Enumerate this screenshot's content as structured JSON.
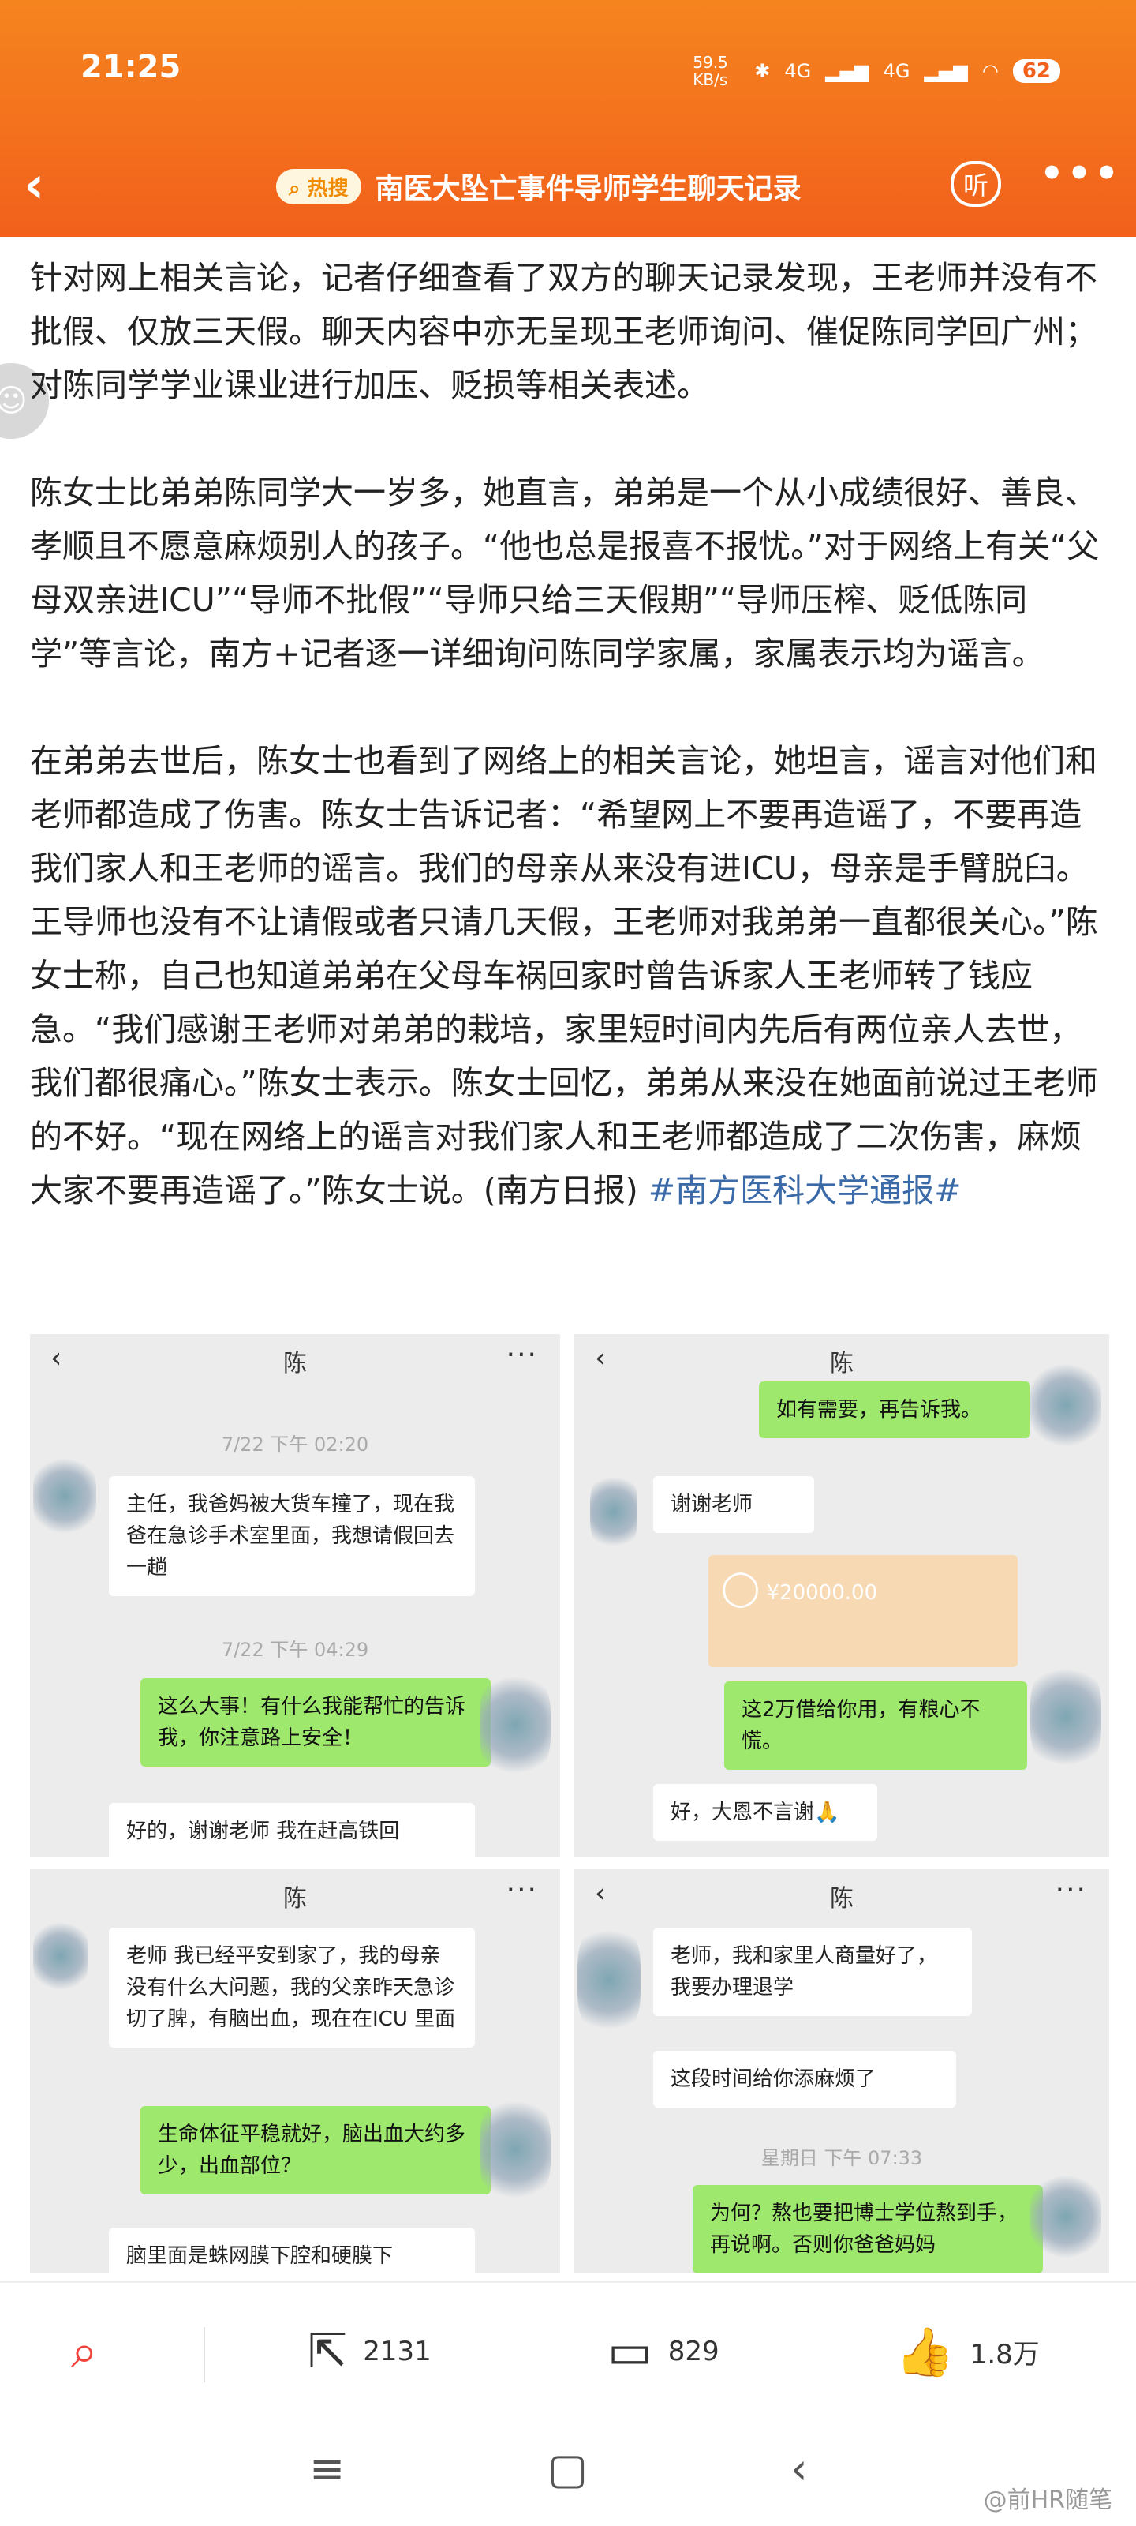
{
  "status": {
    "time": "21:25",
    "net_speed": "59.5 KB/s",
    "network": "4G",
    "network2": "4G",
    "battery": "62"
  },
  "nav": {
    "hot_label": "热搜",
    "title": "南医大坠亡事件导师学生聊天记录",
    "listen_label": "听"
  },
  "article": {
    "p1": "针对网上相关言论，记者仔细查看了双方的聊天记录发现，王老师并没有不批假、仅放三天假。聊天内容中亦无呈现王老师询问、催促陈同学回广州；对陈同学学业课业进行加压、贬损等相关表述。",
    "p2": "陈女士比弟弟陈同学大一岁多，她直言，弟弟是一个从小成绩很好、善良、孝顺且不愿意麻烦别人的孩子。“他也总是报喜不报忧。”对于网络上有关“父母双亲进ICU”“导师不批假”“导师只给三天假期”“导师压榨、贬低陈同学”等言论，南方+记者逐一详细询问陈同学家属，家属表示均为谣言。",
    "p3": "在弟弟去世后，陈女士也看到了网络上的相关言论，她坦言，谣言对他们和老师都造成了伤害。陈女士告诉记者：“希望网上不要再造谣了，不要再造我们家人和王老师的谣言。我们的母亲从来没有进ICU，母亲是手臂脱臼。王导师也没有不让请假或者只请几天假，王老师对我弟弟一直都很关心。”陈女士称，自己也知道弟弟在父母车祸回家时曾告诉家人王老师转了钱应急。“我们感谢王老师对弟弟的栽培，家里短时间内先后有两位亲人去世，我们都很痛心。”陈女士表示。陈女士回忆，弟弟从来没在她面前说过王老师的不好。“现在网络上的谣言对我们家人和王老师都造成了二次伤害，麻烦大家不要再造谣了。”陈女士说。(南方日报) ",
    "hashtag": "#南方医科大学通报#"
  },
  "chats": {
    "c1": {
      "name": "陈",
      "ts1": "7/22 下午 02:20",
      "m1": "主任，我爸妈被大货车撞了，现在我爸在急诊手术室里面，我想请假回去一趟",
      "ts2": "7/22 下午 04:29",
      "m2": "这么大事！有什么我能帮忙的告诉我，你注意路上安全！",
      "m3": "好的，谢谢老师 我在赶高铁回"
    },
    "c2": {
      "name": "陈",
      "m1": "如有需要，再告诉我。",
      "m2": "谢谢老师",
      "amount": "¥20000.00",
      "m3": "这2万借给你用，有粮心不慌。",
      "m4": "好，大恩不言谢🙏"
    },
    "c3": {
      "name": "陈",
      "m1": "老师 我已经平安到家了，我的母亲没有什么大问题，我的父亲昨天急诊切了脾，有脑出血，现在在ICU 里面",
      "m2": "生命体征平稳就好，脑出血大约多少，出血部位？",
      "m3": "脑里面是蛛网膜下腔和硬膜下"
    },
    "c4": {
      "name": "陈",
      "m1": "老师，我和家里人商量好了，我要办理退学",
      "m2": "这段时间给你添麻烦了",
      "ts1": "星期日 下午 07:33",
      "m3": "为何？熬也要把博士学位熬到手，再说啊。否则你爸爸妈妈"
    }
  },
  "actions": {
    "share_count": "2131",
    "comment_count": "829",
    "like_count": "1.8万"
  },
  "watermark": "@前HR随笔"
}
